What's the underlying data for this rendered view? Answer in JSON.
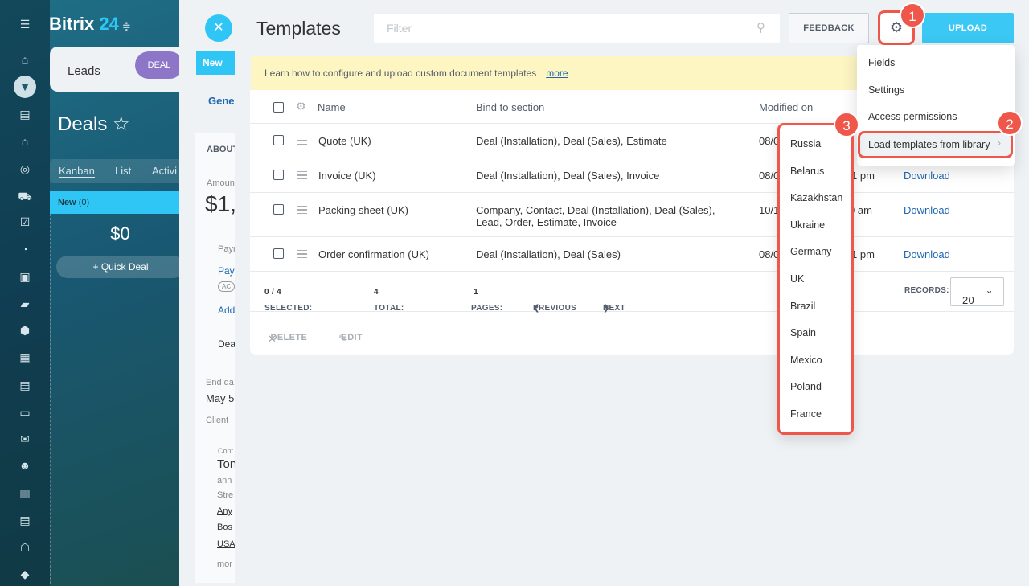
{
  "background": {
    "logo": "Bitrix",
    "logo_num": "24",
    "leads_tab": "Leads",
    "deal_badge": "DEAL",
    "deals_title": "Deals",
    "view_tabs": [
      "Kanban",
      "List",
      "Activi"
    ],
    "column_new": "New",
    "column_new_count": "(0)",
    "column_sum": "$0",
    "quick_deal": "Quick Deal",
    "detail_new_tab": "New",
    "detail_general_tab": "Gene",
    "detail_about": "ABOUT",
    "detail_amount_label": "Amoun",
    "detail_amount": "$1,",
    "detail_pay1": "Paym",
    "detail_pay2": "Pay",
    "detail_ac": "AC",
    "detail_add": "Add",
    "detail_dea": "Dea",
    "detail_end_label": "End da",
    "detail_end": "May 5",
    "detail_client": "Client",
    "detail_cont": "Cont",
    "detail_ton": "Ton",
    "detail_ann": "ann",
    "detail_stre": "Stre",
    "detail_any": "Any",
    "detail_bos": "Bos",
    "detail_usa": "USA",
    "detail_mor": "mor"
  },
  "header": {
    "title": "Templates",
    "filter_placeholder": "Filter",
    "feedback": "FEEDBACK",
    "upload": "UPLOAD"
  },
  "notice": {
    "text": "Learn how to configure and upload custom document templates",
    "link": "more"
  },
  "table": {
    "columns": [
      "Name",
      "Bind to section",
      "Modified on"
    ],
    "rows": [
      {
        "name": "Quote (UK)",
        "bind": "Deal (Installation), Deal (Sales), Estimate",
        "bind2": "",
        "modified": "08/0",
        "time": "",
        "download": ""
      },
      {
        "name": "Invoice (UK)",
        "bind": "Deal (Installation), Deal (Sales), Invoice",
        "bind2": "",
        "modified": "08/0",
        "time": "1 pm",
        "download": "Download"
      },
      {
        "name": "Packing sheet (UK)",
        "bind": "Company, Contact, Deal (Installation), Deal (Sales),",
        "bind2": "Lead, Order, Estimate, Invoice",
        "modified": "10/1",
        "time": "0 am",
        "download": "Download"
      },
      {
        "name": "Order confirmation (UK)",
        "bind": "Deal (Installation), Deal (Sales)",
        "bind2": "",
        "modified": "08/0",
        "time": "1 pm",
        "download": "Download"
      }
    ]
  },
  "footer": {
    "selected_label": "SELECTED:",
    "selected_value": "0 / 4",
    "total_label": "TOTAL:",
    "total_value": "4",
    "pages_label": "PAGES:",
    "pages_value": "1",
    "previous": "PREVIOUS",
    "next": "NEXT",
    "records_label": "RECORDS:",
    "records_value": "20"
  },
  "actions": {
    "delete": "DELETE",
    "edit": "EDIT"
  },
  "menu": {
    "items": [
      "Fields",
      "Settings",
      "Access permissions",
      "Load templates from library"
    ]
  },
  "submenu": {
    "countries": [
      "Russia",
      "Belarus",
      "Kazakhstan",
      "Ukraine",
      "Germany",
      "UK",
      "Brazil",
      "Spain",
      "Mexico",
      "Poland",
      "France"
    ]
  },
  "badges": [
    "1",
    "2",
    "3"
  ],
  "colors": {
    "accent": "#3bc8f5",
    "highlight": "#f0574b",
    "link": "#2067b0",
    "notice_bg": "#fdf6c3"
  }
}
